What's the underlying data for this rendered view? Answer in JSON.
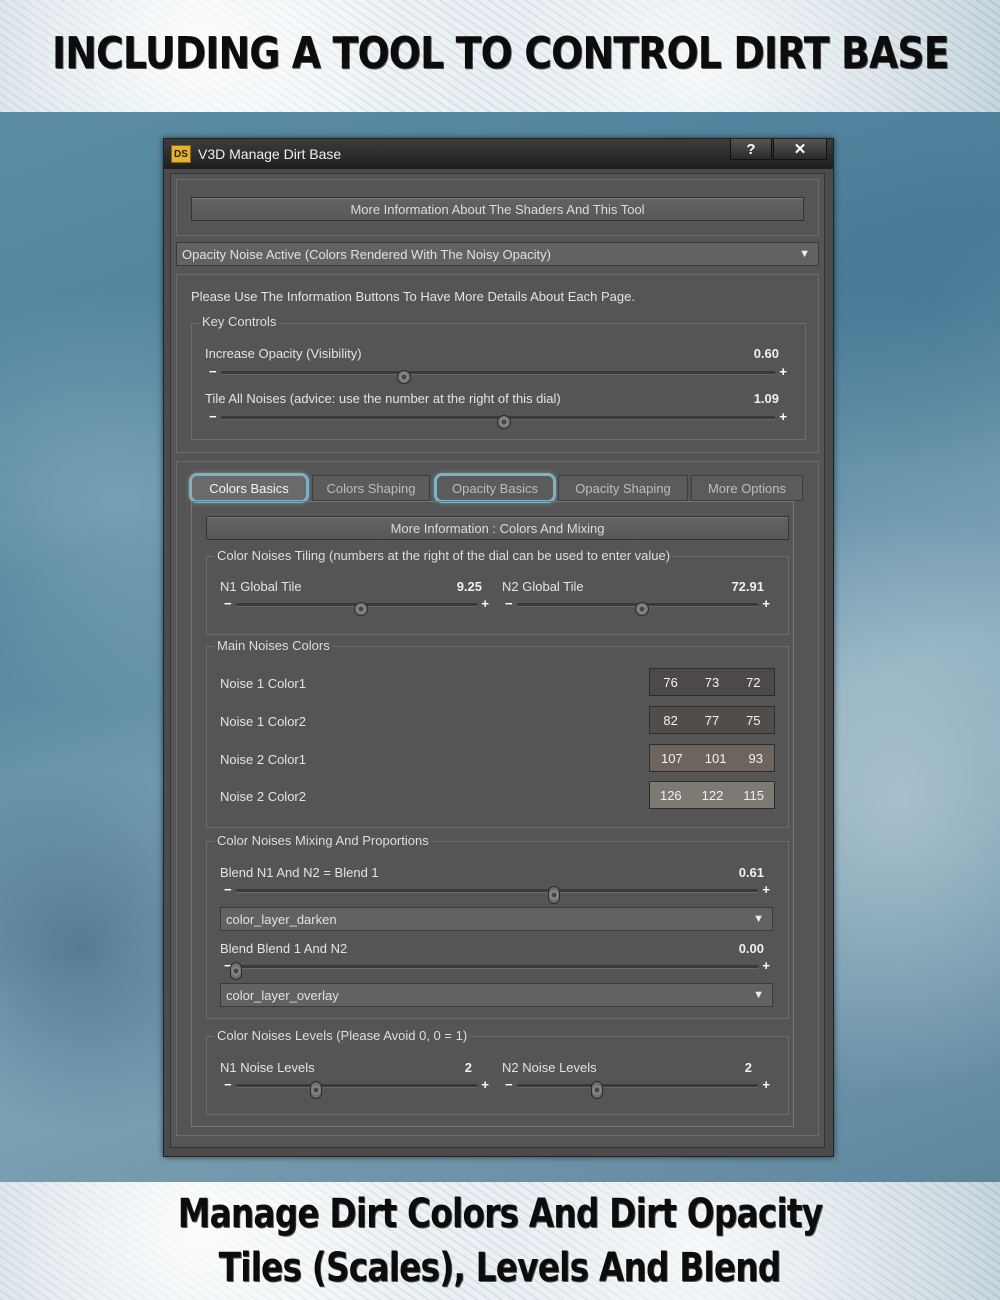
{
  "banners": {
    "top": "INCLUDING A TOOL TO CONTROL DIRT BASE",
    "bottom_line1": "Manage Dirt Colors And Dirt Opacity",
    "bottom_line2": "Tiles (Scales), Levels And Blend"
  },
  "window": {
    "logo": "DS",
    "title": "V3D Manage Dirt Base",
    "help_label": "?",
    "close_label": "✕"
  },
  "info_button": "More Information About The Shaders And This Tool",
  "mode_dropdown": "Opacity Noise Active (Colors Rendered With The Noisy Opacity)",
  "instruction": "Please Use The Information Buttons To Have More Details About Each Page.",
  "key_controls": {
    "title": "Key Controls",
    "opacity": {
      "label": "Increase Opacity (Visibility)",
      "value": "0.60",
      "position": 0.33
    },
    "tile": {
      "label": "Tile All Noises (advice: use the number at the right of this dial)",
      "value": "1.09",
      "position": 0.51
    }
  },
  "tabs": [
    {
      "label": "Colors Basics",
      "active": true,
      "highlight": true
    },
    {
      "label": "Colors Shaping",
      "active": false,
      "highlight": false
    },
    {
      "label": "Opacity Basics",
      "active": false,
      "highlight": true
    },
    {
      "label": "Opacity Shaping",
      "active": false,
      "highlight": false
    },
    {
      "label": "More Options",
      "active": false,
      "highlight": false
    }
  ],
  "tab_info_button": "More Information : Colors And Mixing",
  "tiling": {
    "title": "Color Noises Tiling (numbers at the right of the dial can be used to enter value)",
    "n1": {
      "label": "N1 Global Tile",
      "value": "9.25",
      "position": 0.52
    },
    "n2": {
      "label": "N2 Global Tile",
      "value": "72.91",
      "position": 0.52
    }
  },
  "main_colors": {
    "title": "Main Noises Colors",
    "rows": [
      {
        "label": "Noise 1 Color1",
        "rgb": [
          "76",
          "73",
          "72"
        ],
        "swatch": "#4c4948"
      },
      {
        "label": "Noise 1 Color2",
        "rgb": [
          "82",
          "77",
          "75"
        ],
        "swatch": "#524d4b"
      },
      {
        "label": "Noise 2 Color1",
        "rgb": [
          "107",
          "101",
          "93"
        ],
        "swatch": "#6b655d"
      },
      {
        "label": "Noise 2 Color2",
        "rgb": [
          "126",
          "122",
          "115"
        ],
        "swatch": "#7e7a73"
      }
    ]
  },
  "mixing": {
    "title": "Color Noises Mixing And Proportions",
    "blend1": {
      "label": "Blend N1 And N2 = Blend 1",
      "value": "0.61",
      "position": 0.61
    },
    "blend1_mode": "color_layer_darken",
    "blend2": {
      "label": "Blend Blend 1 And N2",
      "value": "0.00",
      "position": 0.0
    },
    "blend2_mode": "color_layer_overlay"
  },
  "levels": {
    "title": "Color Noises Levels (Please Avoid 0, 0 = 1)",
    "n1": {
      "label": "N1 Noise Levels",
      "value": "2",
      "position": 0.33
    },
    "n2": {
      "label": "N2 Noise Levels",
      "value": "2",
      "position": 0.33
    }
  },
  "slider_signs": {
    "minus": "−",
    "plus": "+"
  },
  "dropdown_arrow": "▼"
}
